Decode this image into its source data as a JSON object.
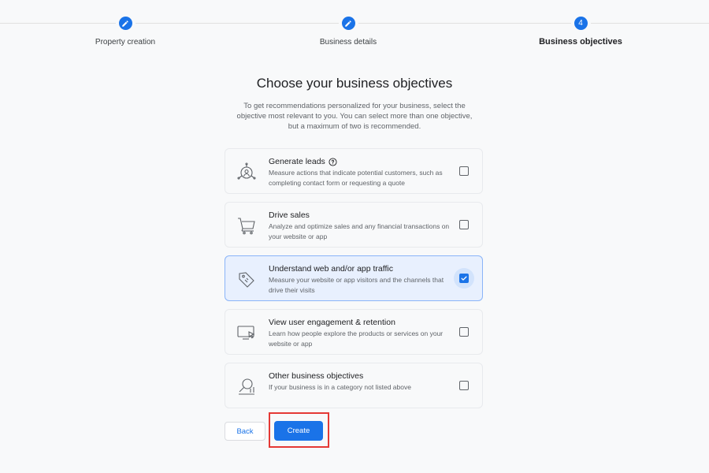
{
  "stepper": {
    "steps": [
      {
        "label": "Property creation",
        "indicator": "pencil-icon"
      },
      {
        "label": "Business details",
        "indicator": "pencil-icon"
      },
      {
        "label": "Business objectives",
        "number": "4"
      }
    ]
  },
  "page": {
    "title": "Choose your business objectives",
    "description": "To get recommendations personalized for your business, select the objective most relevant to you. You can select more than one objective, but a maximum of two is recommended."
  },
  "objectives": [
    {
      "title": "Generate leads",
      "description": "Measure actions that indicate potential customers, such as completing contact form or requesting a quote",
      "icon": "leads-icon",
      "checked": false,
      "has_help": true
    },
    {
      "title": "Drive sales",
      "description": "Analyze and optimize sales and any financial transactions on your website or app",
      "icon": "cart-icon",
      "checked": false
    },
    {
      "title": "Understand web and/or app traffic",
      "description": "Measure your website or app visitors and the channels that drive their visits",
      "icon": "tag-icon",
      "checked": true
    },
    {
      "title": "View user engagement & retention",
      "description": "Learn how people explore the products or services on your website or app",
      "icon": "screen-cursor-icon",
      "checked": false
    },
    {
      "title": "Other business objectives",
      "description": "If your business is in a category not listed above",
      "icon": "magnifier-icon",
      "checked": false
    }
  ],
  "actions": {
    "back_label": "Back",
    "create_label": "Create"
  },
  "colors": {
    "accent": "#1a73e8",
    "selected_bg": "#e8f0fe",
    "highlight": "#e53935"
  }
}
